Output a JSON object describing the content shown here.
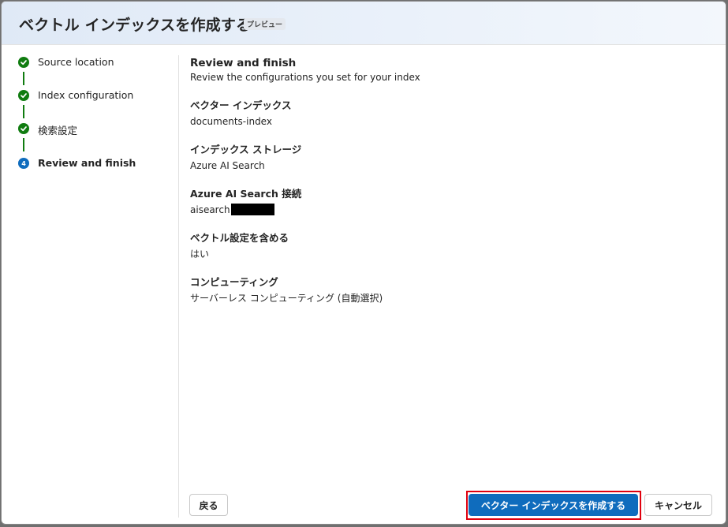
{
  "header": {
    "title": "ベクトル インデックスを作成する",
    "badge": "プレビュー"
  },
  "stepper": {
    "steps": [
      {
        "label": "Source location",
        "state": "done"
      },
      {
        "label": "Index configuration",
        "state": "done"
      },
      {
        "label": "検索設定",
        "state": "done"
      },
      {
        "label": "Review and finish",
        "state": "current",
        "number": "4"
      }
    ]
  },
  "review": {
    "title": "Review and finish",
    "description": "Review the configurations you set for your index",
    "fields": [
      {
        "label": "ベクター インデックス",
        "value": "documents-index"
      },
      {
        "label": "インデックス ストレージ",
        "value": "Azure AI Search"
      },
      {
        "label": "Azure AI Search 接続",
        "value": "aisearch"
      },
      {
        "label": "ベクトル設定を含める",
        "value": "はい"
      },
      {
        "label": "コンピューティング",
        "value": "サーバーレス コンピューティング (自動選択)"
      }
    ]
  },
  "footer": {
    "back_label": "戻る",
    "create_label": "ベクター インデックスを作成する",
    "cancel_label": "キャンセル"
  },
  "colors": {
    "accent": "#0f6cbd",
    "success": "#107c10",
    "highlight": "#e0000e"
  }
}
